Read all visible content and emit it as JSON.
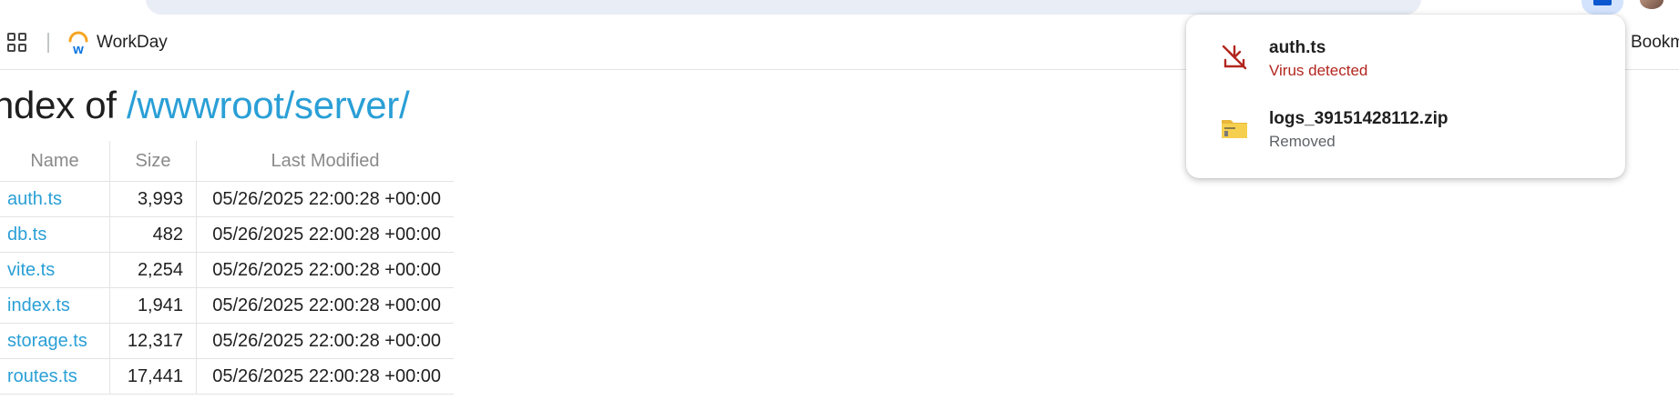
{
  "bookmarks": {
    "items": [
      {
        "label": "WorkDay"
      }
    ],
    "overflow_label": "Bookm"
  },
  "page": {
    "heading_prefix": "ndex of ",
    "heading_path": "/wwwroot/server/",
    "columns": {
      "name": "Name",
      "size": "Size",
      "modified": "Last Modified"
    },
    "rows": [
      {
        "name": "auth.ts",
        "size": "3,993",
        "modified": "05/26/2025 22:00:28 +00:00"
      },
      {
        "name": "db.ts",
        "size": "482",
        "modified": "05/26/2025 22:00:28 +00:00"
      },
      {
        "name": "vite.ts",
        "size": "2,254",
        "modified": "05/26/2025 22:00:28 +00:00"
      },
      {
        "name": "index.ts",
        "size": "1,941",
        "modified": "05/26/2025 22:00:28 +00:00"
      },
      {
        "name": "storage.ts",
        "size": "12,317",
        "modified": "05/26/2025 22:00:28 +00:00"
      },
      {
        "name": "routes.ts",
        "size": "17,441",
        "modified": "05/26/2025 22:00:28 +00:00"
      }
    ]
  },
  "downloads": {
    "items": [
      {
        "filename": "auth.ts",
        "status": "Virus detected",
        "icon": "download-blocked-icon",
        "status_color": "#b3261e"
      },
      {
        "filename": "logs_39151428112.zip",
        "status": "Removed",
        "icon": "zip-folder-icon",
        "status_color": "#5f6368"
      }
    ]
  },
  "colors": {
    "link": "#2a9fd6",
    "danger": "#b3261e",
    "accent": "#0b57d0"
  }
}
